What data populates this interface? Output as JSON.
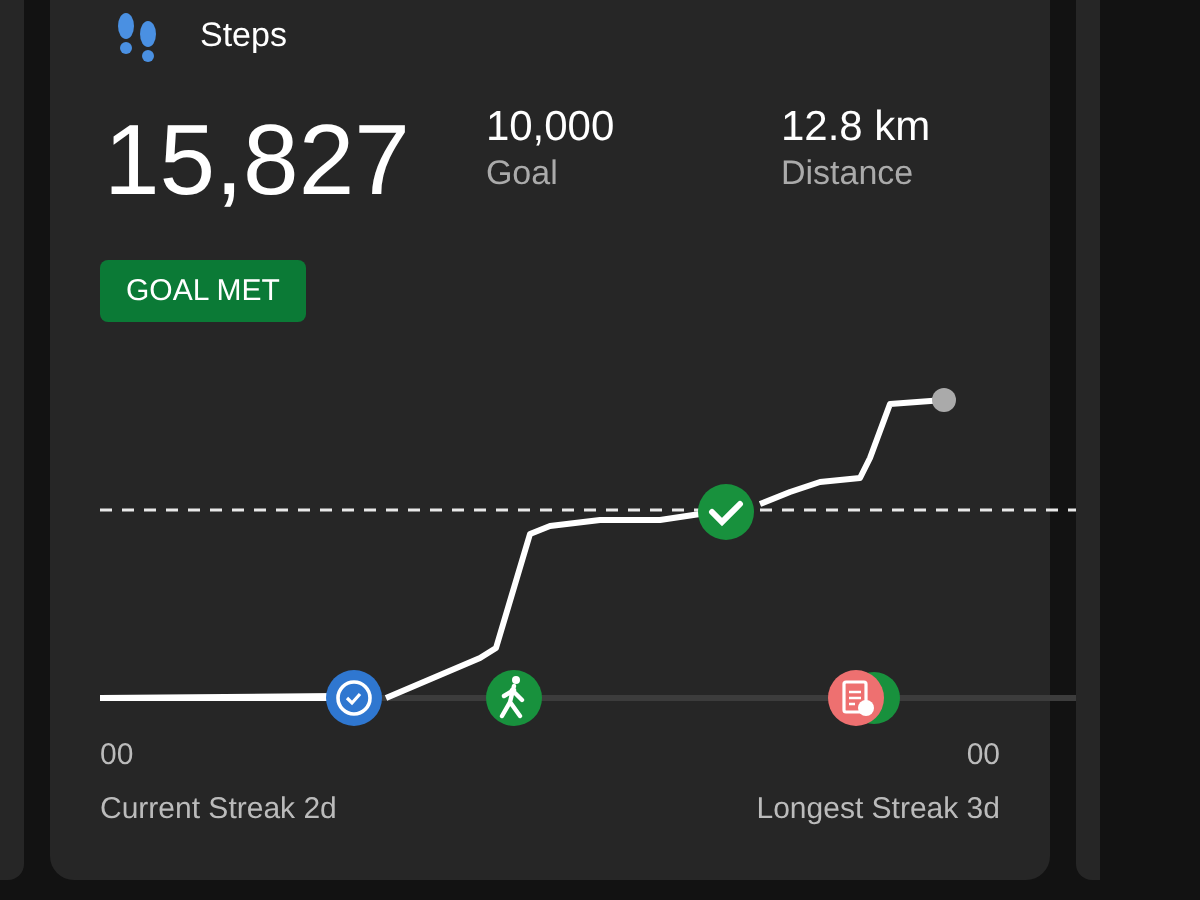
{
  "card": {
    "title": "Steps",
    "value": "15,827",
    "stats": [
      {
        "value": "10,000",
        "label": "Goal"
      },
      {
        "value": "12.8 km",
        "label": "Distance"
      }
    ],
    "badge": "GOAL MET",
    "chart": {
      "left_axis": "00",
      "right_axis": "00"
    },
    "streaks": [
      "Current Streak 2d",
      "Longest Streak 3d"
    ]
  }
}
